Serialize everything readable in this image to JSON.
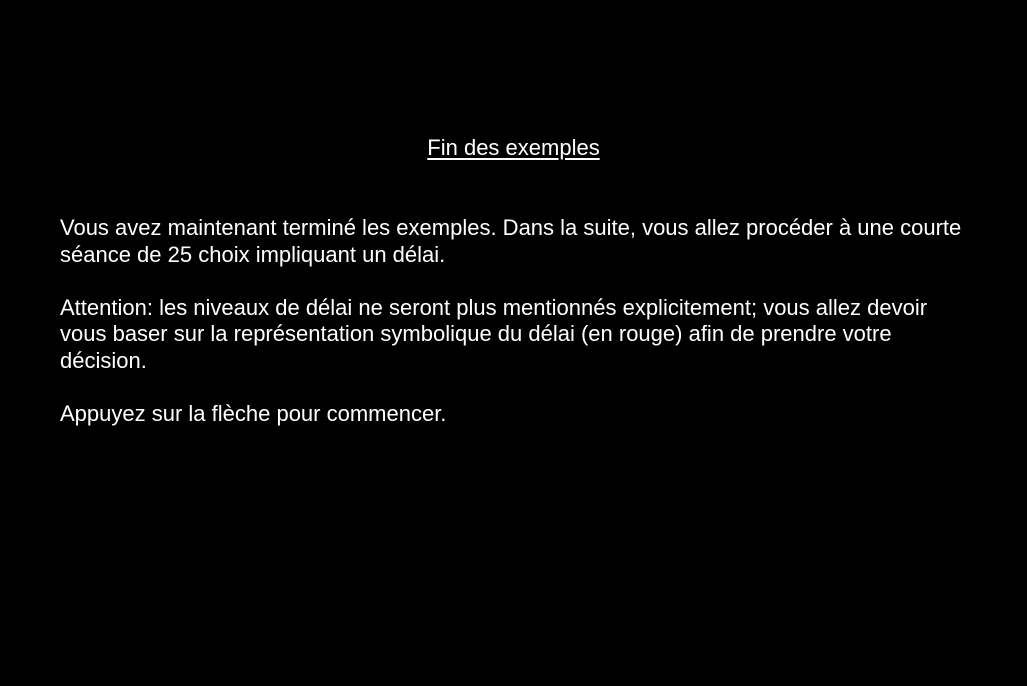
{
  "colors": {
    "background": "#000000",
    "text": "#ffffff"
  },
  "title": "Fin des exemples",
  "paragraphs": [
    "Vous avez maintenant terminé les exemples. Dans la suite, vous allez procéder à une courte séance de 25 choix impliquant un délai.",
    "Attention: les niveaux de délai ne seront plus mentionnés explicitement; vous allez devoir vous baser sur la représentation symbolique du délai (en rouge) afin de prendre votre décision.",
    "Appuyez sur la flèche pour commencer."
  ]
}
